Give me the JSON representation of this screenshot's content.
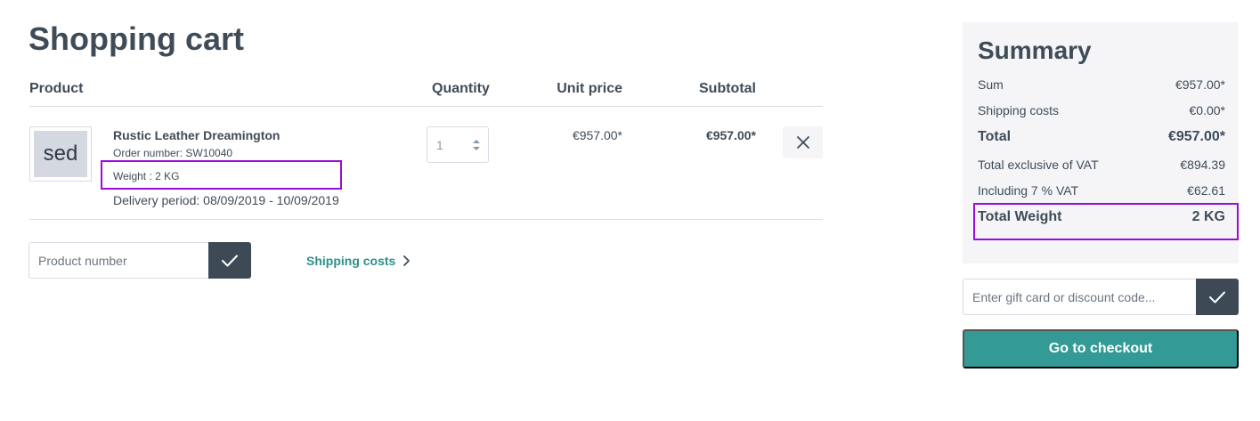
{
  "page": {
    "title": "Shopping cart"
  },
  "table": {
    "headers": {
      "product": "Product",
      "quantity": "Quantity",
      "unit_price": "Unit price",
      "subtotal": "Subtotal"
    }
  },
  "item": {
    "thumb_text": "sed",
    "name": "Rustic Leather Dreamington",
    "order_number": "Order number: SW10040",
    "weight": "Weight : 2 KG",
    "delivery": "Delivery period: 08/09/2019 - 10/09/2019",
    "quantity": "1",
    "unit_price": "€957.00*",
    "subtotal": "€957.00*"
  },
  "actions": {
    "product_number_placeholder": "Product number",
    "shipping_costs_link": "Shipping costs"
  },
  "summary": {
    "title": "Summary",
    "rows": [
      {
        "label": "Sum",
        "value": "€957.00*"
      },
      {
        "label": "Shipping costs",
        "value": "€0.00*"
      },
      {
        "label": "Total",
        "value": "€957.00*"
      },
      {
        "label": "Total exclusive of VAT",
        "value": "€894.39"
      },
      {
        "label": "Including 7 % VAT",
        "value": "€62.61"
      },
      {
        "label": "Total Weight",
        "value": "2 KG"
      }
    ],
    "gift_placeholder": "Enter gift card or discount code...",
    "checkout_label": "Go to checkout"
  },
  "colors": {
    "accent": "#339a96",
    "dark_button": "#3d4a56",
    "highlight": "#9b0cd6",
    "text": "#3f4c58"
  },
  "icons": {
    "remove": "close-icon",
    "confirm": "checkmark-icon",
    "link_arrow": "chevron-right-icon",
    "stepper": "up-down-arrows-icon"
  }
}
